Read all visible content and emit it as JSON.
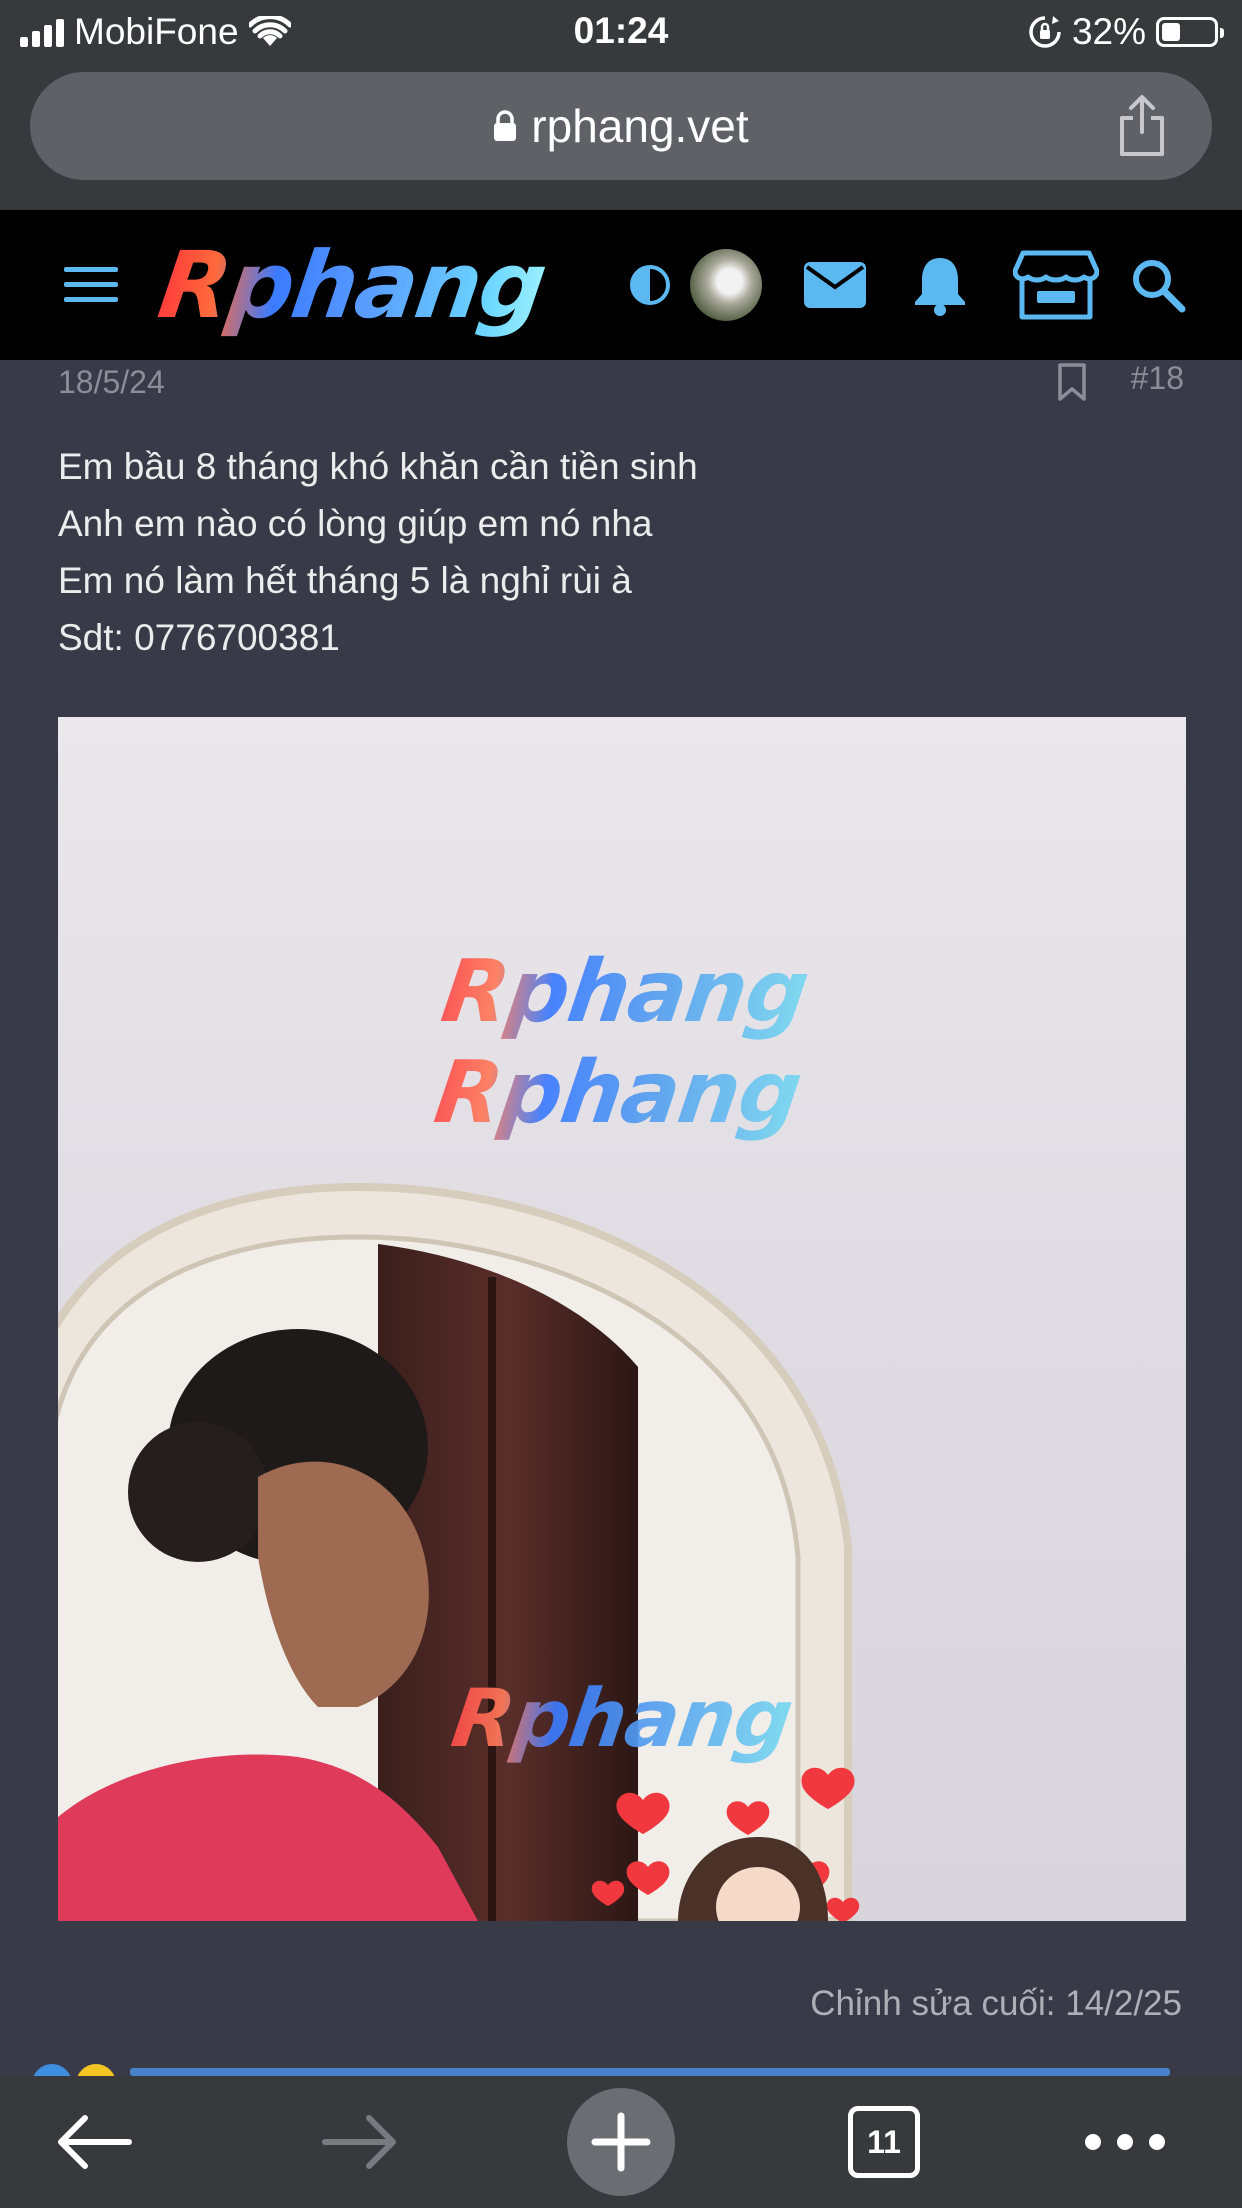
{
  "status_bar": {
    "carrier": "MobiFone",
    "time": "01:24",
    "battery_percent_text": "32%",
    "battery_level": 0.32
  },
  "browser": {
    "url": "rphang.vet"
  },
  "site": {
    "logo_text": "Rphang",
    "icons": [
      "menu-icon",
      "contrast-toggle-icon",
      "avatar",
      "mail-icon",
      "bell-icon",
      "store-icon",
      "search-icon"
    ],
    "accent_color": "#5bb8f0"
  },
  "post": {
    "date": "18/5/24",
    "number": "#18",
    "lines": [
      "Em bầu 8 tháng khó khăn cần tiền sinh",
      "Anh em nào có lòng giúp em nó nha",
      "Em nó làm hết tháng 5 là nghỉ rùi à",
      "Sdt: 0776700381"
    ],
    "image": {
      "watermarks": [
        "Rphang",
        "Rphang",
        "Rphang"
      ]
    },
    "edit_note": "Chỉnh sửa cuối: 14/2/25"
  },
  "toolbar": {
    "tab_count": "11"
  }
}
